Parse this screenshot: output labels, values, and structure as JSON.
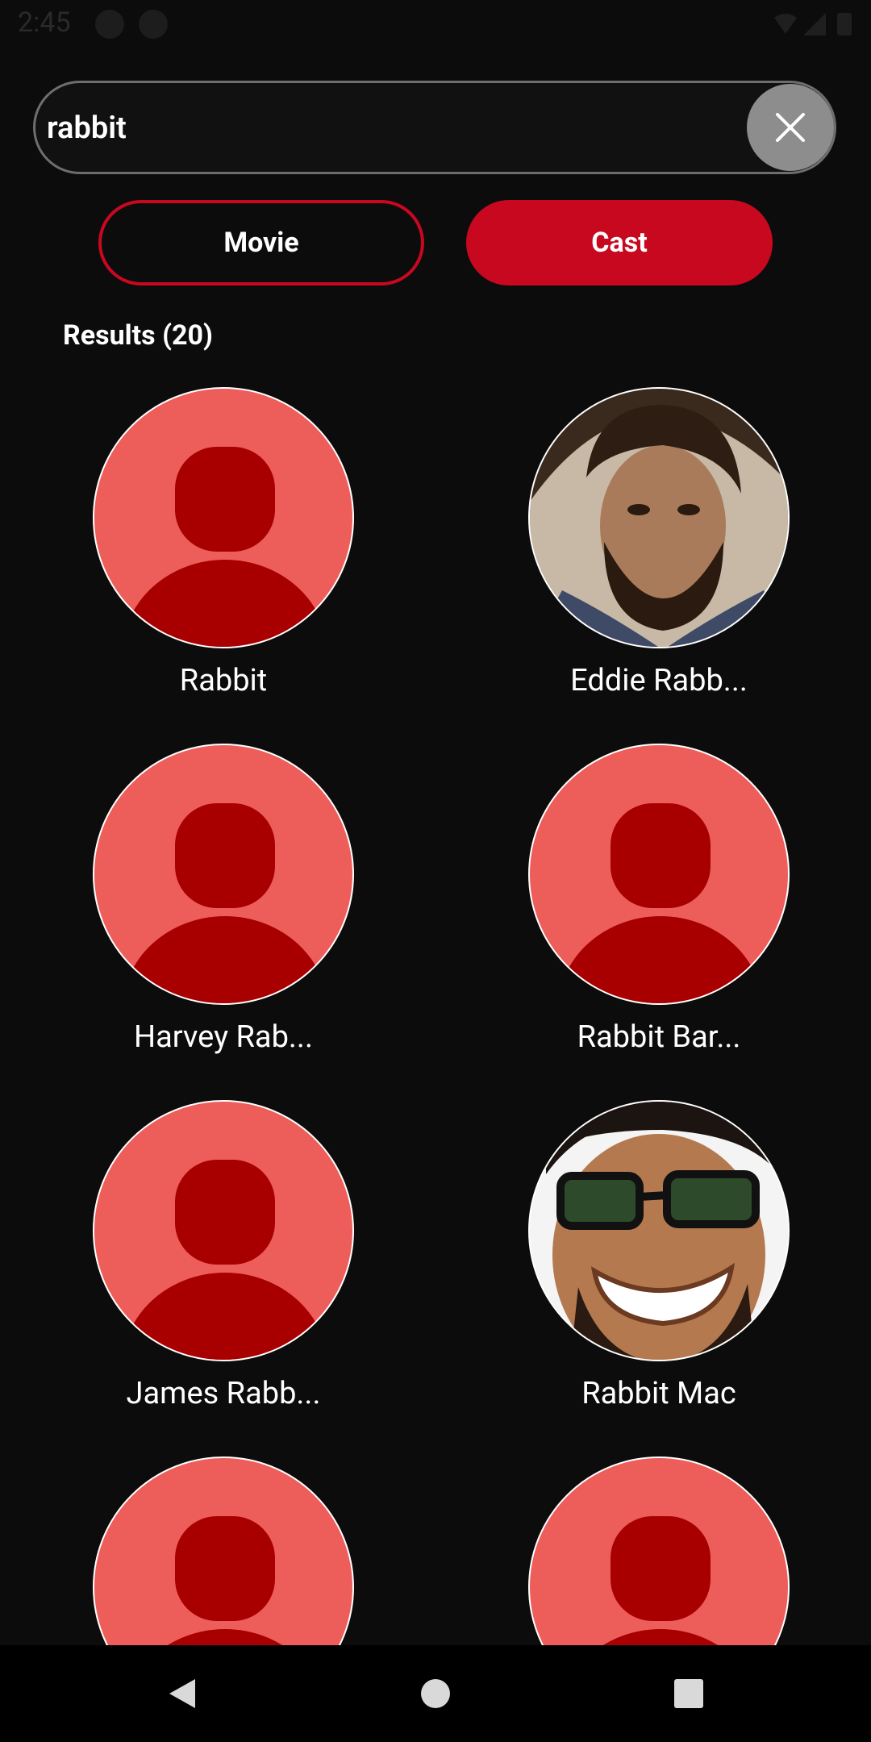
{
  "status": {
    "time": "2:45"
  },
  "search": {
    "value": "rabbit",
    "clear_icon": "close-icon"
  },
  "toggles": {
    "movie_label": "Movie",
    "cast_label": "Cast",
    "selected": "Cast"
  },
  "results": {
    "label": "Results (20)",
    "items": [
      {
        "name": "Rabbit",
        "avatar": "placeholder"
      },
      {
        "name": "Eddie Rabb...",
        "avatar": "photo-bearded-man"
      },
      {
        "name": "Harvey Rab...",
        "avatar": "placeholder"
      },
      {
        "name": "Rabbit Bar...",
        "avatar": "placeholder"
      },
      {
        "name": "James Rabb...",
        "avatar": "placeholder"
      },
      {
        "name": "Rabbit Mac",
        "avatar": "photo-man-glasses"
      },
      {
        "name": "",
        "avatar": "placeholder"
      },
      {
        "name": "",
        "avatar": "placeholder"
      }
    ]
  },
  "colors": {
    "accent": "#c8081f",
    "background": "#0c0c0d",
    "placeholder_bg": "#ed5e5b",
    "placeholder_fg": "#a80000"
  },
  "nav": {
    "back_icon": "back-triangle-icon",
    "home_icon": "home-circle-icon",
    "recents_icon": "recents-square-icon"
  }
}
